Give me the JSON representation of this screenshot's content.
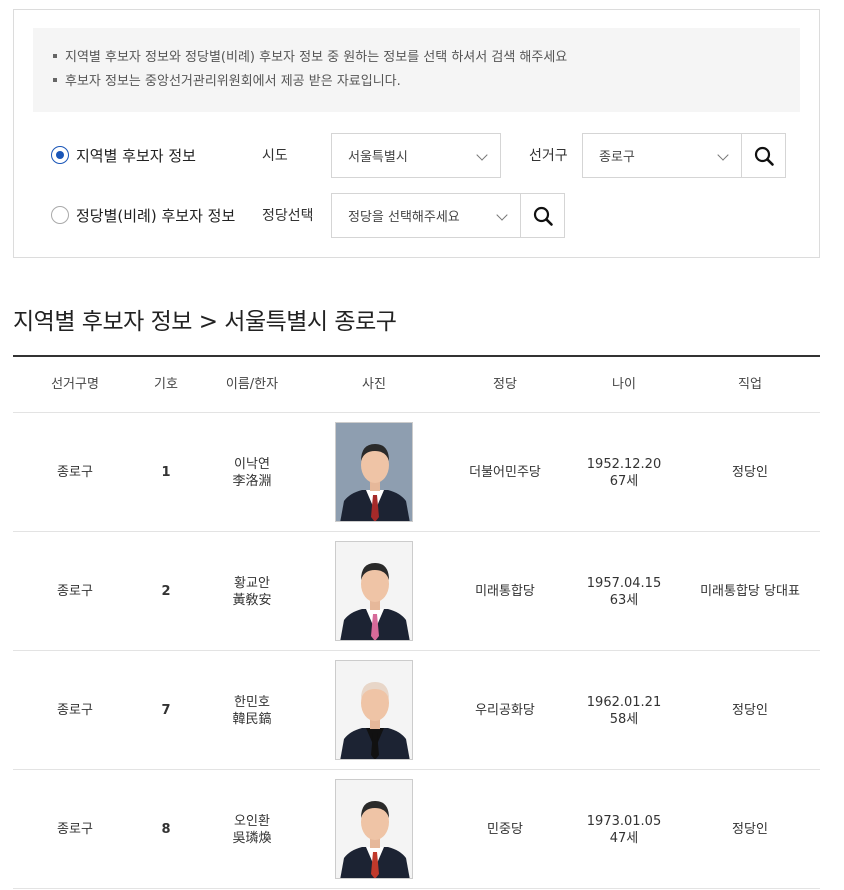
{
  "notice": {
    "line1": "지역별 후보자 정보와 정당별(비례) 후보자 정보 중 원하는 정보를 선택 하셔서 검색 해주세요",
    "line2": "후보자 정보는 중앙선거관리위원회에서 제공 받은 자료입니다."
  },
  "search": {
    "region_option": "지역별 후보자 정보",
    "party_option": "정당별(비례) 후보자 정보",
    "selected_option": "region",
    "sido_label": "시도",
    "sido_value": "서울특별시",
    "district_label": "선거구",
    "district_value": "종로구",
    "party_label": "정당선택",
    "party_placeholder": "정당을 선택해주세요"
  },
  "section_title": "지역별 후보자 정보 > 서울특별시 종로구",
  "table": {
    "headers": [
      "선거구명",
      "기호",
      "이름/한자",
      "사진",
      "정당",
      "나이",
      "직업"
    ],
    "rows": [
      {
        "district": "종로구",
        "number": "1",
        "name": "이낙연",
        "hanja": "李洛淵",
        "party": "더불어민주당",
        "birth": "1952.12.20",
        "age": "67세",
        "job": "정당인",
        "tie": "#a52a2a",
        "shirt": "#ffffff",
        "hair": "#2a2a2a",
        "suit": "#1c2333"
      },
      {
        "district": "종로구",
        "number": "2",
        "name": "황교안",
        "hanja": "黃敎安",
        "party": "미래통합당",
        "birth": "1957.04.15",
        "age": "63세",
        "job": "미래통합당 당대표",
        "tie": "#d66a9a",
        "shirt": "#ffffff",
        "hair": "#2a2a2a",
        "suit": "#1c2333"
      },
      {
        "district": "종로구",
        "number": "7",
        "name": "한민호",
        "hanja": "韓民鎬",
        "party": "우리공화당",
        "birth": "1962.01.21",
        "age": "58세",
        "job": "정당인",
        "tie": "#111111",
        "shirt": "#111111",
        "hair": "#e8d6c8",
        "suit": "#1c2333"
      },
      {
        "district": "종로구",
        "number": "8",
        "name": "오인환",
        "hanja": "吳璘煥",
        "party": "민중당",
        "birth": "1973.01.05",
        "age": "47세",
        "job": "정당인",
        "tie": "#c0392b",
        "shirt": "#ffffff",
        "hair": "#2a2a2a",
        "suit": "#1c2333"
      }
    ]
  }
}
